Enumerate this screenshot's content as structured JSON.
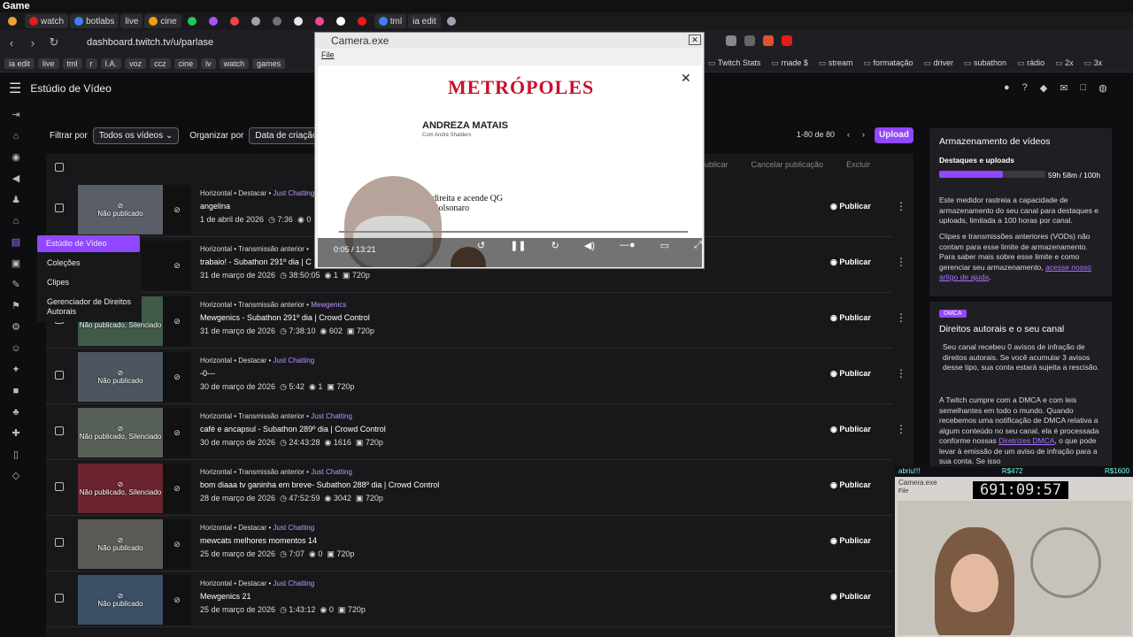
{
  "os_title": "Game",
  "tabs": [
    {
      "label": "",
      "color": "#e8a33d"
    },
    {
      "label": "watch",
      "color": "#e91916"
    },
    {
      "label": "botlabs",
      "color": "#3b82f6"
    },
    {
      "label": "live",
      "color": ""
    },
    {
      "label": "cine",
      "color": "#f59e0b"
    },
    {
      "label": "",
      "color": "#22c55e"
    },
    {
      "label": "",
      "color": "#a855f7"
    },
    {
      "label": "",
      "color": "#ef4444"
    },
    {
      "label": "",
      "color": "#9ca3af"
    },
    {
      "label": "",
      "color": "#6b7280"
    },
    {
      "label": "",
      "color": "#e5e7eb"
    },
    {
      "label": "",
      "color": "#ec4899"
    },
    {
      "label": "",
      "color": "#ffffff"
    },
    {
      "label": "",
      "color": "#e91916"
    },
    {
      "label": "tml",
      "color": "#3b82f6"
    },
    {
      "label": "ia edit",
      "color": ""
    },
    {
      "label": "",
      "color": "#9ca3af"
    }
  ],
  "url": "dashboard.twitch.tv/u/parlase",
  "bookmarks": [
    "ia edit",
    "live",
    "tml",
    "r",
    "I.A.",
    "voz",
    "ccz",
    "cine",
    "lv",
    "watch",
    "games"
  ],
  "bookmarks_right": [
    "Twitch Stats",
    "rnade $",
    "stream",
    "formatação",
    "driver",
    "subathon",
    "rádio",
    "2x",
    "3x"
  ],
  "page_title": "Estúdio de Vídeo",
  "submenu": [
    "Estúdio de Vídeo",
    "Coleções",
    "Clipes",
    "Gerenciador de Direitos Autorais"
  ],
  "filter": {
    "filter_by": "Filtrar por",
    "filter_value": "Todos os vídeos ⌄",
    "organize_by": "Organizar por",
    "organize_value": "Data de criação ⌄",
    "paging": "1-80 de 80",
    "upload": "Upload",
    "bulk_publish": "Publicar",
    "cancel_publish": "Cancelar publicação",
    "delete": "Excluir"
  },
  "videos": [
    {
      "meta": "Horizontal • Destacar • ",
      "cat": "Just Chatting",
      "title": "angelina",
      "date": "1 de abril de 2026",
      "dur": "7:36",
      "views": "0",
      "res": "720p",
      "status": "Não publicado",
      "thumb": "#5a5e66"
    },
    {
      "meta": "Horizontal • Transmissão anterior • ",
      "cat": "",
      "title": "trabaio! - Subathon 291º dia | C",
      "date": "31 de março de 2026",
      "dur": "38:50:05",
      "views": "1",
      "res": "720p",
      "status": "",
      "thumb": "#111"
    },
    {
      "meta": "Horizontal • Transmissão anterior • ",
      "cat": "Mewgenics",
      "title": "Mewgenics - Subathon 291º dia | Crowd Control",
      "date": "31 de março de 2026",
      "dur": "7:38:10",
      "views": "602",
      "res": "720p",
      "status": "Não publicado, Silenciado",
      "thumb": "#3f5a47"
    },
    {
      "meta": "Horizontal • Destacar • ",
      "cat": "Just Chatting",
      "title": "-0---",
      "date": "30 de março de 2026",
      "dur": "5:42",
      "views": "1",
      "res": "720p",
      "status": "Não publicado",
      "thumb": "#4d5560"
    },
    {
      "meta": "Horizontal • Transmissão anterior • ",
      "cat": "Just Chatting",
      "title": "café e ancapsul - Subathon 289º dia | Crowd Control",
      "date": "30 de março de 2026",
      "dur": "24:43:28",
      "views": "1616",
      "res": "720p",
      "status": "Não publicado, Silenciado",
      "thumb": "#566057"
    },
    {
      "meta": "Horizontal • Transmissão anterior • ",
      "cat": "Just Chatting",
      "title": "bom diaaa tv ganinha em breve- Subathon 288º dia | Crowd Control",
      "date": "28 de março de 2026",
      "dur": "47:52:59",
      "views": "3042",
      "res": "720p",
      "status": "Não publicado, Silenciado",
      "thumb": "#6b2430"
    },
    {
      "meta": "Horizontal • Destacar • ",
      "cat": "Just Chatting",
      "title": "mewcats melhores momentos 14",
      "date": "25 de março de 2026",
      "dur": "7:07",
      "views": "0",
      "res": "720p",
      "status": "Não publicado",
      "thumb": "#5b5a56"
    },
    {
      "meta": "Horizontal • Destacar • ",
      "cat": "Just Chatting",
      "title": "Mewgenics 21",
      "date": "25 de março de 2026",
      "dur": "1:43:12",
      "views": "0",
      "res": "720p",
      "status": "Não publicado",
      "thumb": "#3b4f66"
    }
  ],
  "publish_label": "Publicar",
  "storage": {
    "title": "Armazenamento de vídeos",
    "sub": "Destaques e uploads",
    "usage": "59h 58m / 100h",
    "fill": 0.5997,
    "p1": "Este medidor rastreia a capacidade de armazenamento do seu canal para destaques e uploads, limitada a 100 horas por canal.",
    "p2": "Clipes e transmissões anteriores (VODs) não contam para esse limite de armazenamento. Para saber mais sobre esse limite e como gerenciar seu armazenamento, ",
    "p2link": "acesse nosso artigo de ajuda",
    "p2end": "."
  },
  "dmca": {
    "badge": "DMCA",
    "title": "Direitos autorais e o seu canal",
    "p1": "Seu canal recebeu 0 avisos de infração de direitos autorais. Se você acumular 3 avisos desse tipo, sua conta estará sujeita a rescisão.",
    "p2": "A Twitch cumpre com a DMCA e com leis semelhantes em todo o mundo. Quando recebemos uma notificação de DMCA relativa a algum conteúdo no seu canal, ela é processada conforme nossas ",
    "p2link": "Diretrizes DMCA",
    "p2end": ", o que pode levar à emissão de um aviso de infração para a sua conta. Se isso"
  },
  "camera": {
    "title": "Camera.exe",
    "menu": "File",
    "site_logo": "METRÓPOLES",
    "headline": "ANDREZA MATAIS",
    "subhead": "Com André Shalders",
    "lead": "cresce na direita e acende QG de Flávio Bolsonaro",
    "time": "0:05 / 13:21"
  },
  "webcam": {
    "left": "abriu!!!",
    "mid": "R$472",
    "right": "R$1600",
    "title": "Camera.exe",
    "file": "File",
    "timer": "691:09:57"
  }
}
